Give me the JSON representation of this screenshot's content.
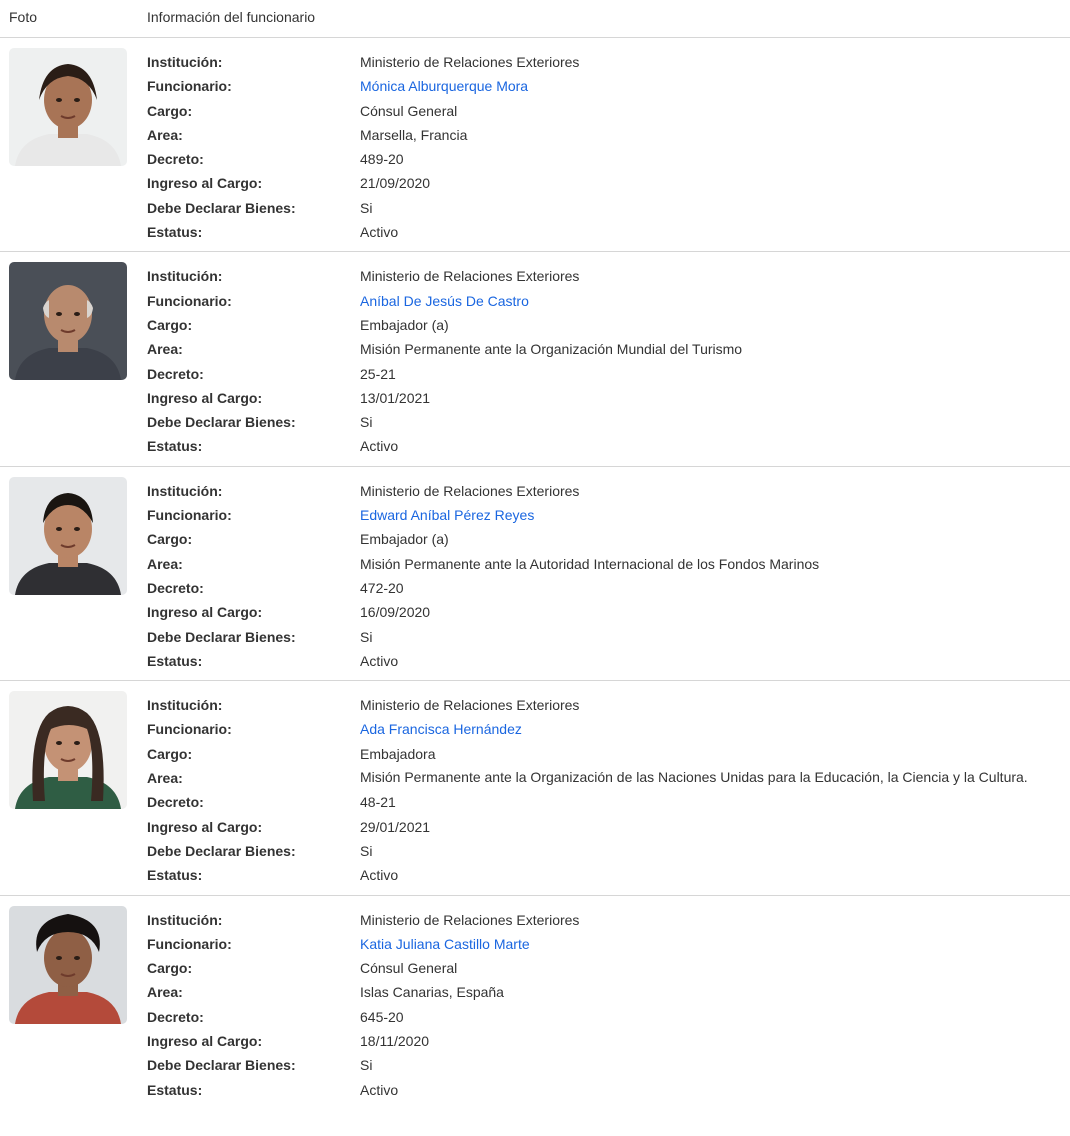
{
  "header": {
    "photo": "Foto",
    "info": "Información del funcionario"
  },
  "labels": {
    "institucion": "Institución:",
    "funcionario": "Funcionario:",
    "cargo": "Cargo:",
    "area": "Area:",
    "decreto": "Decreto:",
    "ingreso": "Ingreso al Cargo:",
    "bienes": "Debe Declarar Bienes:",
    "estatus": "Estatus:"
  },
  "colors": {
    "link": "#1a66e0",
    "divider": "#d6d6d6",
    "text": "#333333"
  },
  "officials": [
    {
      "institucion": "Ministerio de Relaciones Exteriores",
      "funcionario": "Mónica Alburquerque Mora",
      "cargo": "Cónsul General",
      "area": "Marsella, Francia",
      "decreto": "489-20",
      "ingreso": "21/09/2020",
      "bienes": "Si",
      "estatus": "Activo"
    },
    {
      "institucion": "Ministerio de Relaciones Exteriores",
      "funcionario": "Aníbal De Jesús De Castro",
      "cargo": "Embajador (a)",
      "area": "Misión Permanente ante la Organización Mundial del Turismo",
      "decreto": "25-21",
      "ingreso": "13/01/2021",
      "bienes": "Si",
      "estatus": "Activo"
    },
    {
      "institucion": "Ministerio de Relaciones Exteriores",
      "funcionario": "Edward Aníbal Pérez Reyes",
      "cargo": "Embajador (a)",
      "area": "Misión Permanente ante la Autoridad Internacional de los Fondos Marinos",
      "decreto": "472-20",
      "ingreso": "16/09/2020",
      "bienes": "Si",
      "estatus": "Activo"
    },
    {
      "institucion": "Ministerio de Relaciones Exteriores",
      "funcionario": "Ada Francisca Hernández",
      "cargo": "Embajadora",
      "area": "Misión Permanente ante la Organización de las Naciones Unidas para la Educación, la Ciencia y la Cultura.",
      "decreto": "48-21",
      "ingreso": "29/01/2021",
      "bienes": "Si",
      "estatus": "Activo"
    },
    {
      "institucion": "Ministerio de Relaciones Exteriores",
      "funcionario": "Katia Juliana Castillo Marte",
      "cargo": "Cónsul General",
      "area": "Islas Canarias, España",
      "decreto": "645-20",
      "ingreso": "18/11/2020",
      "bienes": "Si",
      "estatus": "Activo"
    }
  ]
}
